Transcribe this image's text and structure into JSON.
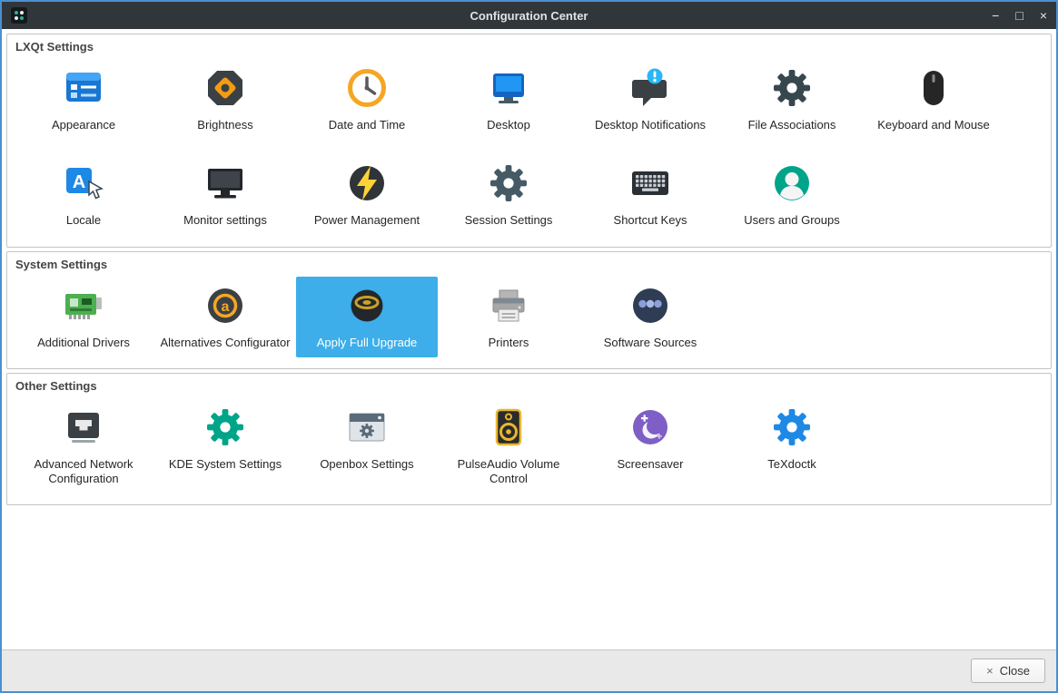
{
  "window": {
    "title": "Configuration Center",
    "minimize_glyph": "−",
    "maximize_glyph": "□",
    "close_glyph": "×"
  },
  "groups": [
    {
      "title": "LXQt Settings",
      "items": [
        {
          "label": "Appearance",
          "icon": "appearance-icon"
        },
        {
          "label": "Brightness",
          "icon": "brightness-icon"
        },
        {
          "label": "Date and Time",
          "icon": "date-time-icon"
        },
        {
          "label": "Desktop",
          "icon": "desktop-icon"
        },
        {
          "label": "Desktop Notifications",
          "icon": "desktop-notifications-icon"
        },
        {
          "label": "File Associations",
          "icon": "file-associations-icon"
        },
        {
          "label": "Keyboard and Mouse",
          "icon": "keyboard-mouse-icon"
        },
        {
          "label": "Locale",
          "icon": "locale-icon"
        },
        {
          "label": "Monitor settings",
          "icon": "monitor-settings-icon"
        },
        {
          "label": "Power Management",
          "icon": "power-management-icon"
        },
        {
          "label": "Session Settings",
          "icon": "session-settings-icon"
        },
        {
          "label": "Shortcut Keys",
          "icon": "shortcut-keys-icon"
        },
        {
          "label": "Users and Groups",
          "icon": "users-groups-icon"
        }
      ]
    },
    {
      "title": "System Settings",
      "items": [
        {
          "label": "Additional Drivers",
          "icon": "additional-drivers-icon"
        },
        {
          "label": "Alternatives Configurator",
          "icon": "alternatives-configurator-icon"
        },
        {
          "label": "Apply Full Upgrade",
          "icon": "apply-full-upgrade-icon",
          "selected": true
        },
        {
          "label": "Printers",
          "icon": "printers-icon"
        },
        {
          "label": "Software Sources",
          "icon": "software-sources-icon"
        }
      ]
    },
    {
      "title": "Other Settings",
      "items": [
        {
          "label": "Advanced Network Configuration",
          "icon": "advanced-network-icon"
        },
        {
          "label": "KDE System Settings",
          "icon": "kde-settings-icon"
        },
        {
          "label": "Openbox Settings",
          "icon": "openbox-settings-icon"
        },
        {
          "label": "PulseAudio Volume Control",
          "icon": "pulseaudio-icon"
        },
        {
          "label": "Screensaver",
          "icon": "screensaver-icon"
        },
        {
          "label": "TeXdoctk",
          "icon": "texdoctk-icon"
        }
      ]
    }
  ],
  "footer": {
    "close_label": "Close",
    "close_icon_glyph": "×"
  },
  "colors": {
    "selection": "#3daee9",
    "titlebar_bg": "#31363b",
    "window_border": "#4a90d2"
  }
}
